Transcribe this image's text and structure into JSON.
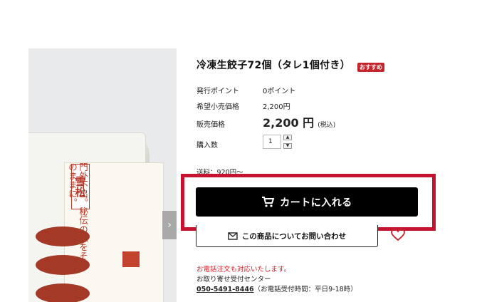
{
  "product": {
    "title": "冷凍生餃子72個（タレ1個付き）",
    "badge": "おすすめ",
    "image_logo": "雪松",
    "image_text": "門外不出。秘伝の味をそのままに。",
    "image_alt": "frozen-gyoza-package"
  },
  "info": {
    "points_label": "発行ポイント",
    "points_value": "0ポイント",
    "msrp_label": "希望小売価格",
    "msrp_value": "2,200円",
    "price_label": "販売価格",
    "price_value": "2,200 円",
    "price_tax": "(税込)",
    "qty_label": "購入数",
    "qty_value": "1",
    "shipping": "送料：920円〜"
  },
  "buttons": {
    "cart_label": "カートに入れる",
    "inquiry_label": "この商品についてお問い合わせ"
  },
  "contact": {
    "phone_note": "お電話注文も対応いたします。",
    "center": "お取り寄せ受付センター",
    "phone_number": "050-5491-8446",
    "hours": "（お電話受付時間：平日9-18時）"
  },
  "colors": {
    "highlight": "#c41230",
    "cart_button": "#000000",
    "badge": "#c4262e"
  },
  "icons": {
    "cart": "cart-icon",
    "mail": "mail-icon",
    "heart": "heart-icon",
    "next": "chevron-right-icon"
  }
}
